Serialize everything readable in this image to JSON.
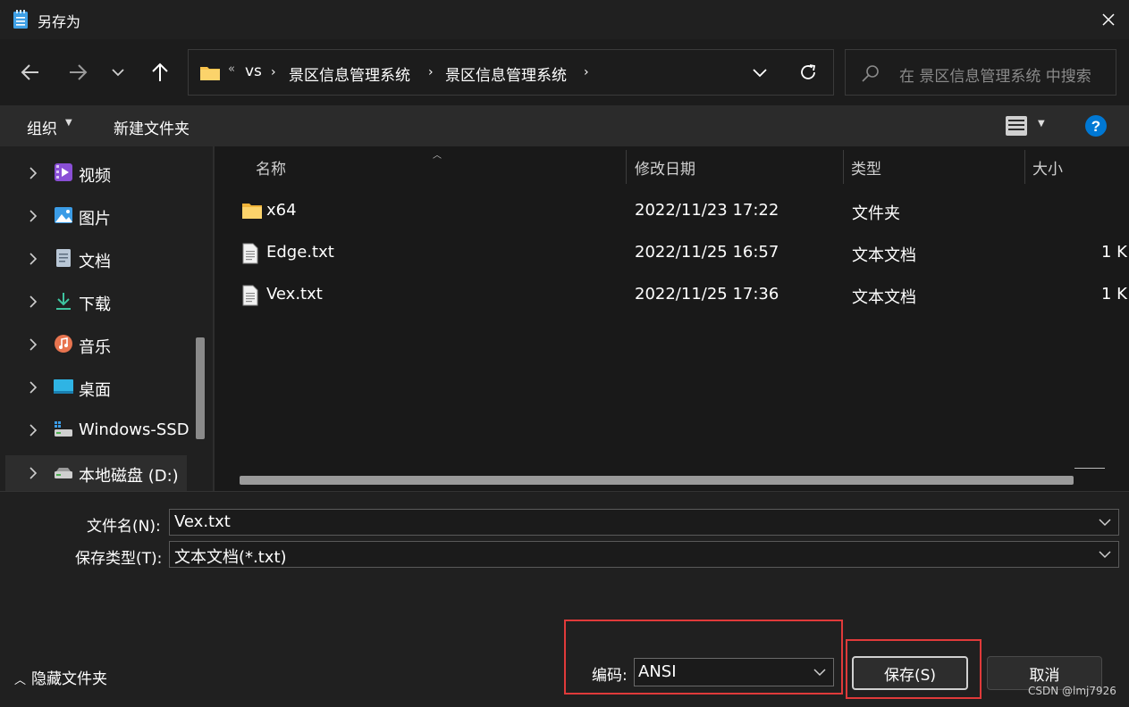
{
  "window": {
    "title": "另存为"
  },
  "address": {
    "overflow": "«",
    "parts": [
      "vs",
      "景区信息管理系统",
      "景区信息管理系统"
    ]
  },
  "search": {
    "placeholder": "在 景区信息管理系统 中搜索"
  },
  "toolbar": {
    "organize": "组织",
    "new_folder": "新建文件夹"
  },
  "sidebar": {
    "items": [
      {
        "label": "视频",
        "icon": "video-icon"
      },
      {
        "label": "图片",
        "icon": "pictures-icon"
      },
      {
        "label": "文档",
        "icon": "documents-icon"
      },
      {
        "label": "下载",
        "icon": "downloads-icon"
      },
      {
        "label": "音乐",
        "icon": "music-icon"
      },
      {
        "label": "桌面",
        "icon": "desktop-icon"
      },
      {
        "label": "Windows-SSD",
        "icon": "drive-icon"
      },
      {
        "label": "本地磁盘 (D:)",
        "icon": "local-disk-icon",
        "selected": true
      }
    ]
  },
  "columns": {
    "name": "名称",
    "modified": "修改日期",
    "type": "类型",
    "size": "大小"
  },
  "files": [
    {
      "name": "x64",
      "modified": "2022/11/23 17:22",
      "type": "文件夹",
      "size": "",
      "icon": "folder-icon"
    },
    {
      "name": "Edge.txt",
      "modified": "2022/11/25 16:57",
      "type": "文本文档",
      "size": "1 K",
      "icon": "text-file-icon"
    },
    {
      "name": "Vex.txt",
      "modified": "2022/11/25 17:36",
      "type": "文本文档",
      "size": "1 K",
      "icon": "text-file-icon"
    }
  ],
  "form": {
    "filename_label": "文件名(N):",
    "filename_value": "Vex.txt",
    "filetype_label": "保存类型(T):",
    "filetype_value": "文本文档(*.txt)",
    "encoding_label": "编码:",
    "encoding_value": "ANSI"
  },
  "buttons": {
    "save": "保存(S)",
    "cancel": "取消"
  },
  "hide_folders": "隐藏文件夹",
  "watermark": "CSDN @lmj7926",
  "colors": {
    "accent": "#0078d4",
    "highlight_box": "#e03a3a",
    "folder": "#f8c24a"
  }
}
